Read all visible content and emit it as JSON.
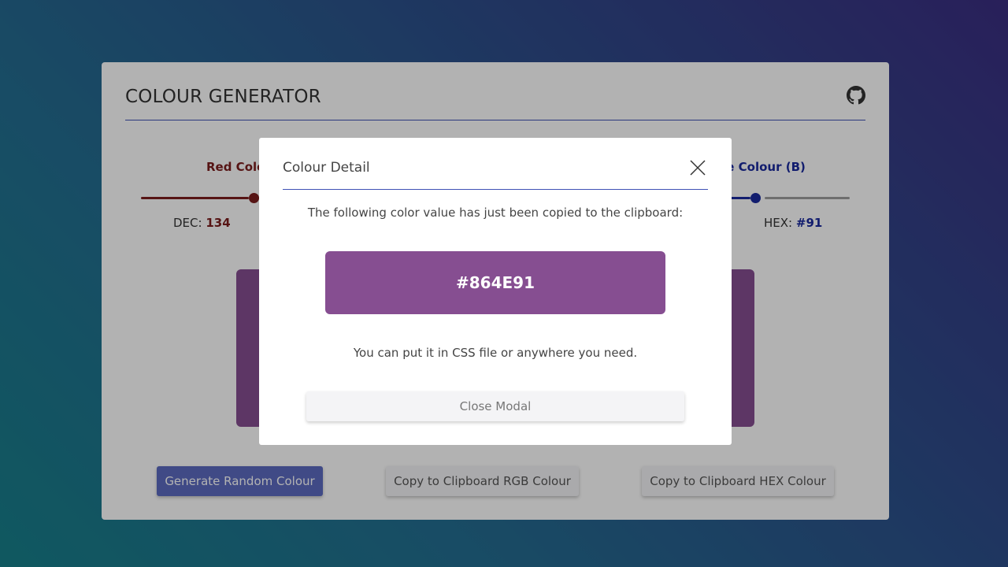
{
  "app": {
    "title": "COLOUR GENERATOR",
    "github_icon": "github-icon"
  },
  "sliders": {
    "red": {
      "label": "Red Colour (R)",
      "readout_label": "DEC:",
      "value": "134",
      "color": "#7b1d1d",
      "fraction": 0.525
    },
    "blue": {
      "label": "Blue Colour (B)",
      "readout_label": "HEX:",
      "value": "#91",
      "color": "#1a2a9e",
      "fraction": 0.57
    }
  },
  "preview": {
    "color": "#864E91"
  },
  "buttons": {
    "generate": "Generate Random Colour",
    "copy_rgb": "Copy to Clipboard RGB Colour",
    "copy_hex": "Copy to Clipboard HEX Colour"
  },
  "modal": {
    "title": "Colour Detail",
    "message": "The following color value has just been copied to the clipboard:",
    "value": "#864E91",
    "hint": "You can put it in CSS file or anywhere you need.",
    "close_label": "Close Modal",
    "close_icon": "close-icon"
  },
  "colors": {
    "accent": "#3f51b5",
    "primary_button": "#5c6bc0",
    "swatch": "#864E91"
  }
}
